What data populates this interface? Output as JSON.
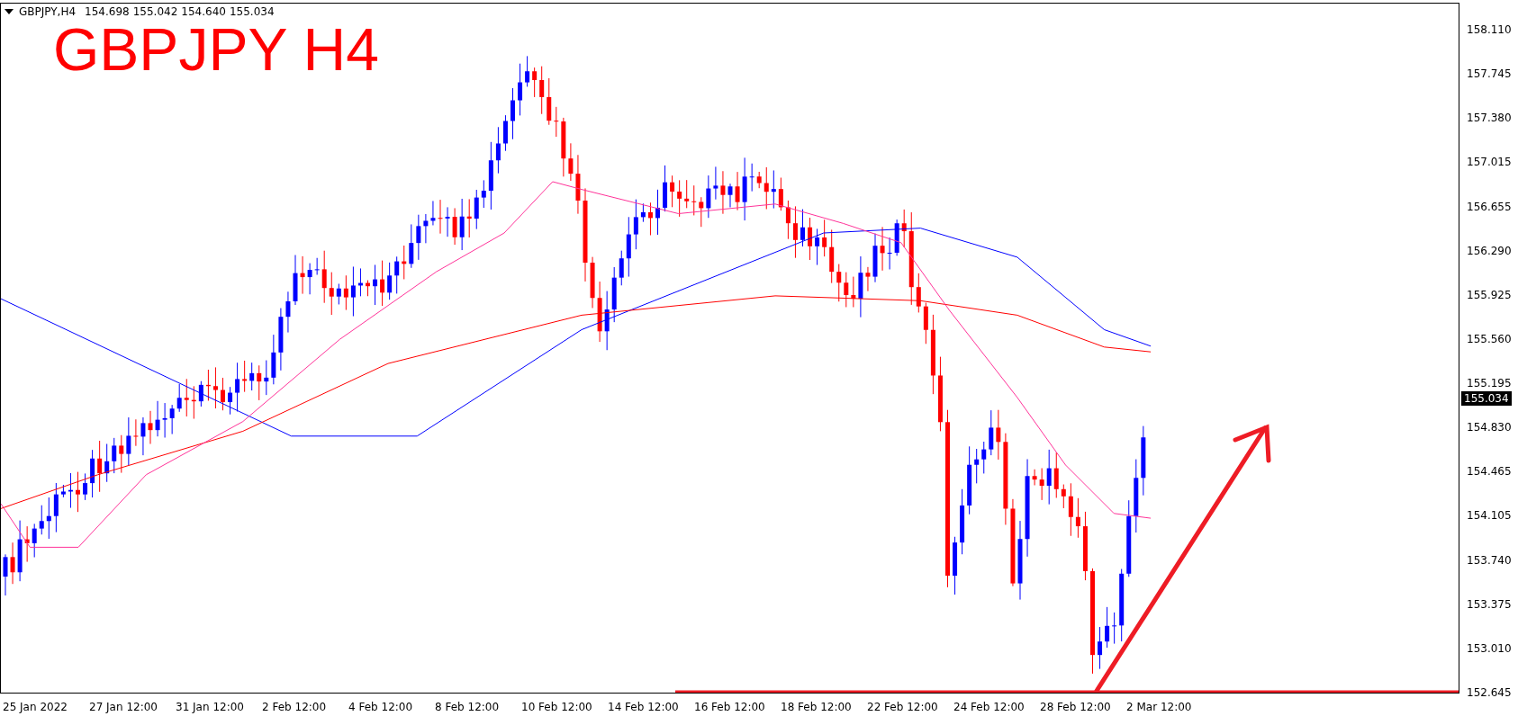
{
  "header": {
    "symbol": "GBPJPY,H4",
    "ohlc": [
      "154.698",
      "155.042",
      "154.640",
      "155.034"
    ]
  },
  "title": "GBPJPY H4",
  "price_axis": {
    "labels": [
      "158.110",
      "157.745",
      "157.380",
      "157.015",
      "156.655",
      "156.290",
      "155.925",
      "155.560",
      "155.195",
      "154.830",
      "154.465",
      "154.105",
      "153.740",
      "153.375",
      "153.010",
      "152.645"
    ],
    "current_price": "155.034"
  },
  "time_axis": {
    "labels": [
      "25 Jan 2022",
      "27 Jan 12:00",
      "31 Jan 12:00",
      "2 Feb 12:00",
      "4 Feb 12:00",
      "8 Feb 12:00",
      "10 Feb 12:00",
      "14 Feb 12:00",
      "16 Feb 12:00",
      "18 Feb 12:00",
      "22 Feb 12:00",
      "24 Feb 12:00",
      "28 Feb 12:00",
      "2 Mar 12:00"
    ]
  }
}
